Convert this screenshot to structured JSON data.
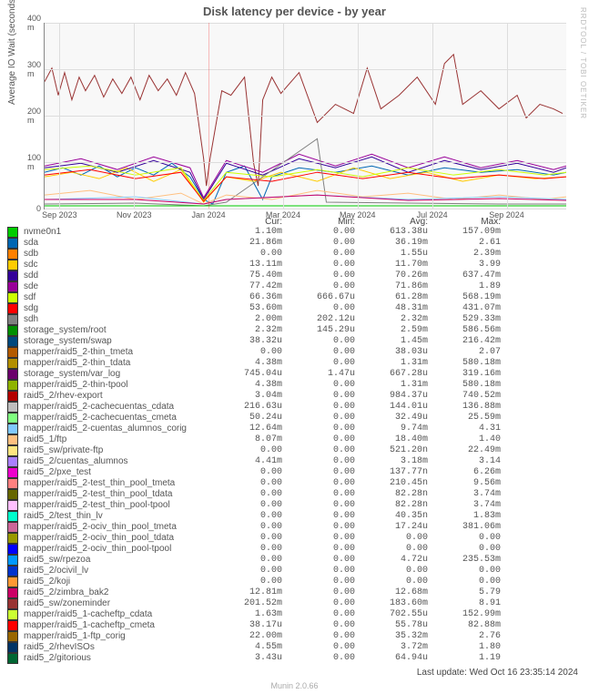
{
  "title": "Disk latency per device - by year",
  "watermark": "RRDTOOL / TOBI OETIKER",
  "ylabel": "Average IO Wait (seconds)",
  "last_update": "Last update: Wed Oct 16 23:35:14 2024",
  "munin_version": "Munin 2.0.66",
  "chart_data": {
    "type": "line",
    "ylim": [
      0,
      400
    ],
    "yunit": "m",
    "yticks": [
      0,
      100,
      200,
      300,
      400
    ],
    "xticks": [
      "Sep 2023",
      "Nov 2023",
      "Jan 2024",
      "Mar 2024",
      "May 2024",
      "Jul 2024",
      "Sep 2024"
    ],
    "headers": [
      "Cur:",
      "Min:",
      "Avg:",
      "Max:"
    ],
    "series": [
      {
        "color": "#00cc00",
        "name": "nvme0n1",
        "cur": "1.10m",
        "min": "0.00",
        "avg": "613.38u",
        "max": "157.09m"
      },
      {
        "color": "#0066b3",
        "name": "sda",
        "cur": "21.86m",
        "min": "0.00",
        "avg": "36.19m",
        "max": "2.61"
      },
      {
        "color": "#ff8000",
        "name": "sdb",
        "cur": "0.00",
        "min": "0.00",
        "avg": "1.55u",
        "max": "2.39m"
      },
      {
        "color": "#ffcc00",
        "name": "sdc",
        "cur": "13.11m",
        "min": "0.00",
        "avg": "11.70m",
        "max": "3.99"
      },
      {
        "color": "#330099",
        "name": "sdd",
        "cur": "75.40m",
        "min": "0.00",
        "avg": "70.26m",
        "max": "637.47m"
      },
      {
        "color": "#990099",
        "name": "sde",
        "cur": "77.42m",
        "min": "0.00",
        "avg": "71.86m",
        "max": "1.89"
      },
      {
        "color": "#ccff00",
        "name": "sdf",
        "cur": "66.36m",
        "min": "666.67u",
        "avg": "61.28m",
        "max": "568.19m"
      },
      {
        "color": "#ff0000",
        "name": "sdg",
        "cur": "53.60m",
        "min": "0.00",
        "avg": "48.31m",
        "max": "431.07m"
      },
      {
        "color": "#808080",
        "name": "sdh",
        "cur": "2.00m",
        "min": "202.12u",
        "avg": "2.32m",
        "max": "529.33m"
      },
      {
        "color": "#008f00",
        "name": "storage_system/root",
        "cur": "2.32m",
        "min": "145.29u",
        "avg": "2.59m",
        "max": "586.56m"
      },
      {
        "color": "#00487d",
        "name": "storage_system/swap",
        "cur": "38.32u",
        "min": "0.00",
        "avg": "1.45m",
        "max": "216.42m"
      },
      {
        "color": "#b35a00",
        "name": "mapper/raid5_2-thin_tmeta",
        "cur": "0.00",
        "min": "0.00",
        "avg": "38.03u",
        "max": "2.07"
      },
      {
        "color": "#b38f00",
        "name": "mapper/raid5_2-thin_tdata",
        "cur": "4.38m",
        "min": "0.00",
        "avg": "1.31m",
        "max": "580.18m"
      },
      {
        "color": "#6b006b",
        "name": "storage_system/var_log",
        "cur": "745.04u",
        "min": "1.47u",
        "avg": "667.28u",
        "max": "319.16m"
      },
      {
        "color": "#8fb300",
        "name": "mapper/raid5_2-thin-tpool",
        "cur": "4.38m",
        "min": "0.00",
        "avg": "1.31m",
        "max": "580.18m"
      },
      {
        "color": "#b30000",
        "name": "raid5_2/rhev-export",
        "cur": "3.04m",
        "min": "0.00",
        "avg": "984.37u",
        "max": "740.52m"
      },
      {
        "color": "#bebebe",
        "name": "mapper/raid5_2-cachecuentas_cdata",
        "cur": "216.63u",
        "min": "0.00",
        "avg": "144.01u",
        "max": "136.88m"
      },
      {
        "color": "#80ff80",
        "name": "mapper/raid5_2-cachecuentas_cmeta",
        "cur": "50.24u",
        "min": "0.00",
        "avg": "32.49u",
        "max": "25.59m"
      },
      {
        "color": "#80c9ff",
        "name": "mapper/raid5_2-cuentas_alumnos_corig",
        "cur": "12.64m",
        "min": "0.00",
        "avg": "9.74m",
        "max": "4.31"
      },
      {
        "color": "#ffc080",
        "name": "raid5_1/ftp",
        "cur": "8.07m",
        "min": "0.00",
        "avg": "18.40m",
        "max": "1.40"
      },
      {
        "color": "#ffe680",
        "name": "raid5_sw/private-ftp",
        "cur": "0.00",
        "min": "0.00",
        "avg": "521.20n",
        "max": "22.49m"
      },
      {
        "color": "#aa80ff",
        "name": "raid5_2/cuentas_alumnos",
        "cur": "4.41m",
        "min": "0.00",
        "avg": "3.18m",
        "max": "3.14"
      },
      {
        "color": "#ee00cc",
        "name": "raid5_2/pxe_test",
        "cur": "0.00",
        "min": "0.00",
        "avg": "137.77n",
        "max": "6.26m"
      },
      {
        "color": "#ff8080",
        "name": "mapper/raid5_2-test_thin_pool_tmeta",
        "cur": "0.00",
        "min": "0.00",
        "avg": "210.45n",
        "max": "9.56m"
      },
      {
        "color": "#666600",
        "name": "mapper/raid5_2-test_thin_pool_tdata",
        "cur": "0.00",
        "min": "0.00",
        "avg": "82.28n",
        "max": "3.74m"
      },
      {
        "color": "#ffbfff",
        "name": "mapper/raid5_2-test_thin_pool-tpool",
        "cur": "0.00",
        "min": "0.00",
        "avg": "82.28n",
        "max": "3.74m"
      },
      {
        "color": "#00ffcc",
        "name": "raid5_2/test_thin_lv",
        "cur": "0.00",
        "min": "0.00",
        "avg": "40.35n",
        "max": "1.83m"
      },
      {
        "color": "#cc6699",
        "name": "mapper/raid5_2-ociv_thin_pool_tmeta",
        "cur": "0.00",
        "min": "0.00",
        "avg": "17.24u",
        "max": "381.06m"
      },
      {
        "color": "#999900",
        "name": "mapper/raid5_2-ociv_thin_pool_tdata",
        "cur": "0.00",
        "min": "0.00",
        "avg": "0.00",
        "max": "0.00"
      },
      {
        "color": "#0000ff",
        "name": "mapper/raid5_2-ociv_thin_pool-tpool",
        "cur": "0.00",
        "min": "0.00",
        "avg": "0.00",
        "max": "0.00"
      },
      {
        "color": "#0099ff",
        "name": "raid5_sw/rpezoa",
        "cur": "0.00",
        "min": "0.00",
        "avg": "4.72u",
        "max": "235.53m"
      },
      {
        "color": "#0033cc",
        "name": "raid5_2/ocivil_lv",
        "cur": "0.00",
        "min": "0.00",
        "avg": "0.00",
        "max": "0.00"
      },
      {
        "color": "#ff9933",
        "name": "raid5_2/koji",
        "cur": "0.00",
        "min": "0.00",
        "avg": "0.00",
        "max": "0.00"
      },
      {
        "color": "#cc0066",
        "name": "raid5_2/zimbra_bak2",
        "cur": "12.81m",
        "min": "0.00",
        "avg": "12.68m",
        "max": "5.79"
      },
      {
        "color": "#993333",
        "name": "raid5_sw/zoneminder",
        "cur": "201.52m",
        "min": "0.00",
        "avg": "183.60m",
        "max": "8.91"
      },
      {
        "color": "#ccff33",
        "name": "mapper/raid5_1-cacheftp_cdata",
        "cur": "1.63m",
        "min": "0.00",
        "avg": "702.55u",
        "max": "152.99m"
      },
      {
        "color": "#ff0000",
        "name": "mapper/raid5_1-cacheftp_cmeta",
        "cur": "38.17u",
        "min": "0.00",
        "avg": "55.78u",
        "max": "82.88m"
      },
      {
        "color": "#996600",
        "name": "mapper/raid5_1-ftp_corig",
        "cur": "22.00m",
        "min": "0.00",
        "avg": "35.32m",
        "max": "2.76"
      },
      {
        "color": "#003366",
        "name": "raid5_2/rhevISOs",
        "cur": "4.55m",
        "min": "0.00",
        "avg": "3.72m",
        "max": "1.80"
      },
      {
        "color": "#006633",
        "name": "raid5_2/gitorious",
        "cur": "3.43u",
        "min": "0.00",
        "avg": "64.94u",
        "max": "1.19"
      }
    ]
  }
}
